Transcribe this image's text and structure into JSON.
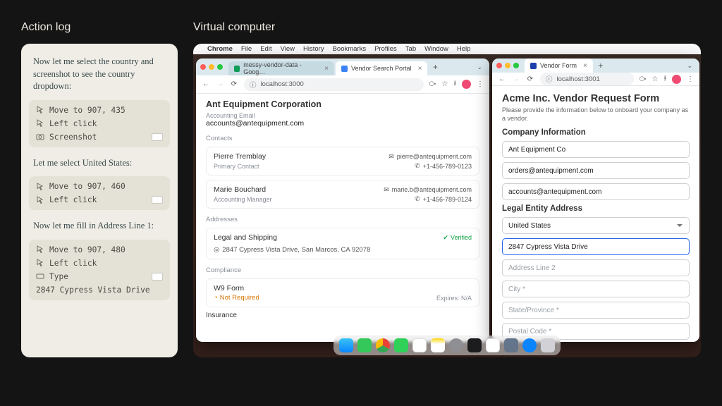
{
  "titles": {
    "left": "Action log",
    "right": "Virtual computer"
  },
  "log": {
    "note1": "Now let me select the country and screenshot to see the country dropdown:",
    "b1": {
      "r1": "Move to  907, 435",
      "r2": "Left click",
      "r3": "Screenshot"
    },
    "note2": "Let me select United States:",
    "b2": {
      "r1": "Move to  907, 460",
      "r2": "Left click"
    },
    "note3": "Now let me fill in Address Line 1:",
    "b3": {
      "r1": "Move to  907, 480",
      "r2": "Left click",
      "r3": "Type",
      "r4": "2847 Cypress Vista Drive"
    }
  },
  "menubar": [
    "Chrome",
    "File",
    "Edit",
    "View",
    "History",
    "Bookmarks",
    "Profiles",
    "Tab",
    "Window",
    "Help"
  ],
  "win1": {
    "tabs": [
      {
        "label": "messy-vendor-data - Goog…",
        "favcolor": "#0f9d58"
      },
      {
        "label": "Vendor Search Portal",
        "favcolor": "#3b82f6"
      }
    ],
    "url": "localhost:3000",
    "company": "Ant Equipment Corporation",
    "acc_label": "Accounting Email",
    "acc_email": "accounts@antequipment.com",
    "contacts_h": "Contacts",
    "contacts": [
      {
        "name": "Pierre Tremblay",
        "role": "Primary Contact",
        "email": "pierre@antequipment.com",
        "phone": "+1-456-789-0123"
      },
      {
        "name": "Marie Bouchard",
        "role": "Accounting Manager",
        "email": "marie.b@antequipment.com",
        "phone": "+1-456-789-0124"
      }
    ],
    "addr_h": "Addresses",
    "addr_title": "Legal and Shipping",
    "verified": "Verified",
    "addr_line": "2847 Cypress Vista Drive, San Marcos, CA 92078",
    "compl_h": "Compliance",
    "w9": "W9 Form",
    "notreq": "Not Required",
    "expires": "Expires: N/A",
    "insurance": "Insurance"
  },
  "win2": {
    "tab": {
      "label": "Vendor Form",
      "favcolor": "#1e40af"
    },
    "url": "localhost:3001",
    "title": "Acme Inc. Vendor Request Form",
    "subtitle": "Please provide the information below to onboard your company as a vendor.",
    "sect1": "Company Information",
    "f_company": "Ant Equipment Co",
    "f_orders": "orders@antequipment.com",
    "f_accounts": "accounts@antequipment.com",
    "sect2": "Legal Entity Address",
    "f_country": "United States",
    "f_addr1": "2847 Cypress Vista Drive",
    "ph_addr2": "Address Line 2",
    "ph_city": "City *",
    "ph_state": "State/Province *",
    "ph_postal": "Postal Code *"
  },
  "dock_colors": [
    "#f2f2f2",
    "#35d05a",
    "#fff",
    "#07c160",
    "#fff",
    "#fbd34d",
    "#6b7280",
    "#2a2a2a",
    "#f5f5f5",
    "#64748b",
    "#0ea5e9",
    "#e6e6e6"
  ]
}
